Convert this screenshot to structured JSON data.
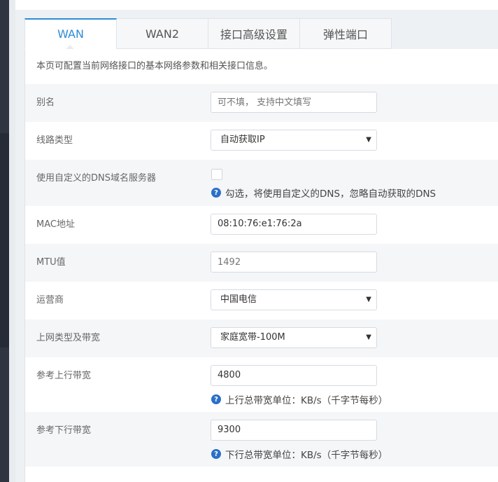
{
  "tabs": [
    {
      "label": "WAN",
      "active": true
    },
    {
      "label": "WAN2",
      "active": false
    },
    {
      "label": "接口高级设置",
      "active": false
    },
    {
      "label": "弹性端口",
      "active": false
    }
  ],
  "description": "本页可配置当前网络接口的基本网络参数和相关接口信息。",
  "form": {
    "alias": {
      "label": "别名",
      "placeholder": "可不填， 支持中文填写",
      "value": ""
    },
    "line_type": {
      "label": "线路类型",
      "selected": "自动获取IP"
    },
    "custom_dns": {
      "label": "使用自定义的DNS域名服务器",
      "checked": false,
      "help": "勾选，将使用自定义的DNS，忽略自动获取的DNS"
    },
    "mac": {
      "label": "MAC地址",
      "value": "08:10:76:e1:76:2a"
    },
    "mtu": {
      "label": "MTU值",
      "placeholder": "1492"
    },
    "isp": {
      "label": "运营商",
      "selected": "中国电信"
    },
    "net_type": {
      "label": "上网类型及带宽",
      "selected": "家庭宽带-100M"
    },
    "upload": {
      "label": "参考上行带宽",
      "value": "4800",
      "help": "上行总带宽单位：KB/s（千字节每秒）"
    },
    "download": {
      "label": "参考下行带宽",
      "value": "9300",
      "help": "下行总带宽单位：KB/s（千字节每秒）"
    }
  },
  "icons": {
    "help": "question-circle-icon",
    "caret": "caret-down-icon"
  },
  "colors": {
    "accent": "#2d8cd6",
    "help_icon": "#2b6fc6",
    "sidebar": "#2f3541"
  }
}
